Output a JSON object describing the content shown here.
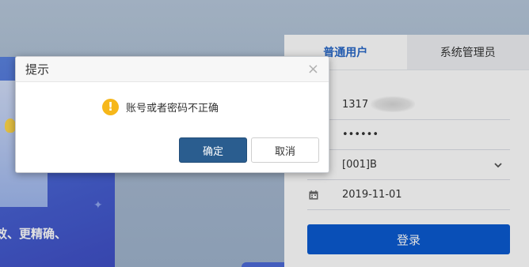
{
  "hero": {
    "slogan": "效、更精确、"
  },
  "login": {
    "tabs": [
      {
        "label": "普通用户",
        "active": true
      },
      {
        "label": "系统管理员",
        "active": false
      }
    ],
    "username": "1317",
    "password_mask": "••••••",
    "org_select": "[001]B",
    "date": "2019-11-01",
    "submit_label": "登录"
  },
  "dialog": {
    "title": "提示",
    "close_glyph": "×",
    "icon_glyph": "!",
    "message": "账号或者密码不正确",
    "ok_label": "确定",
    "cancel_label": "取消"
  },
  "colors": {
    "accent": "#0b5ad1",
    "tab_active": "#2868c8",
    "warning": "#f6b71a",
    "ok_button": "#2a5d8f"
  }
}
